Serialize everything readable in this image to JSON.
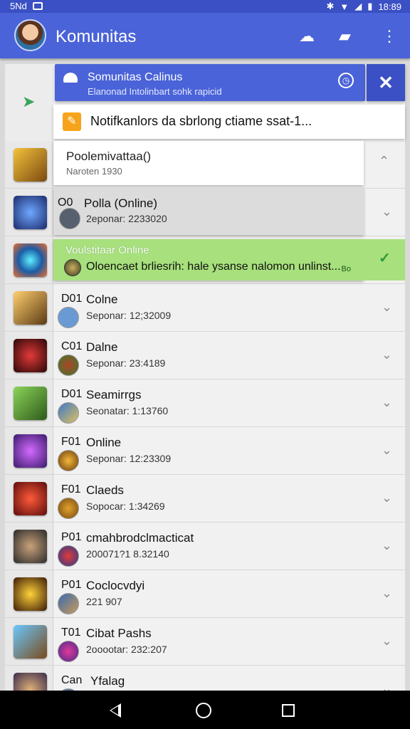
{
  "status_bar": {
    "left_text": "5Nd",
    "time": "18:89"
  },
  "app_bar": {
    "title": "Komunitas",
    "icons": [
      "avatar",
      "mood-icon",
      "compose-icon",
      "overflow-menu-icon"
    ]
  },
  "notification": {
    "title": "Somunitas Calinus",
    "subtitle": "Elanonad Intolinbart sohk rapicid",
    "close_label": "✕",
    "banner_text": "Notifkanlors da sbrlong ctiame ssat-1..."
  },
  "expanded_card": {
    "title": "Poolemivattaa()",
    "subtitle": "Naroten 1930"
  },
  "highlight_card": {
    "title": "Voulstitaar Online",
    "message": "Oloencaet brliesrih: hale ysanse nalomon unlinst...",
    "tag": "Bo"
  },
  "rows": [
    {
      "prefix": "O0",
      "title": "Polla (Online)",
      "sub": "2eponar: 2233020"
    },
    {
      "prefix": "",
      "title": "",
      "sub": ""
    },
    {
      "prefix": "D01",
      "title": "Colne",
      "sub": "Seponar: 12;32009"
    },
    {
      "prefix": "C01",
      "title": "Dalne",
      "sub": "Seponar: 23:4189"
    },
    {
      "prefix": "D01",
      "title": "Seamirrgs",
      "sub": "Seonatar: 1:13760"
    },
    {
      "prefix": "F01",
      "title": "Online",
      "sub": "Seponar: 12:23309"
    },
    {
      "prefix": "F01",
      "title": "Claeds",
      "sub": "Sopocar: 1:34269"
    },
    {
      "prefix": "P01",
      "title": "cmahbrodclmacticat",
      "sub": "200071?1 8.32140"
    },
    {
      "prefix": "P01",
      "title": "Coclocvdyi",
      "sub": "221 907"
    },
    {
      "prefix": "T01",
      "title": "Cibat Pashs",
      "sub": "2ooootar: 232:207"
    },
    {
      "prefix": "Can",
      "title": "Yfalag",
      "sub": ""
    }
  ],
  "colors": {
    "app_bar": "#4a63d8",
    "status_bar": "#3a50c4",
    "highlight": "#a7e07c",
    "banner_icon": "#f6a41c"
  }
}
